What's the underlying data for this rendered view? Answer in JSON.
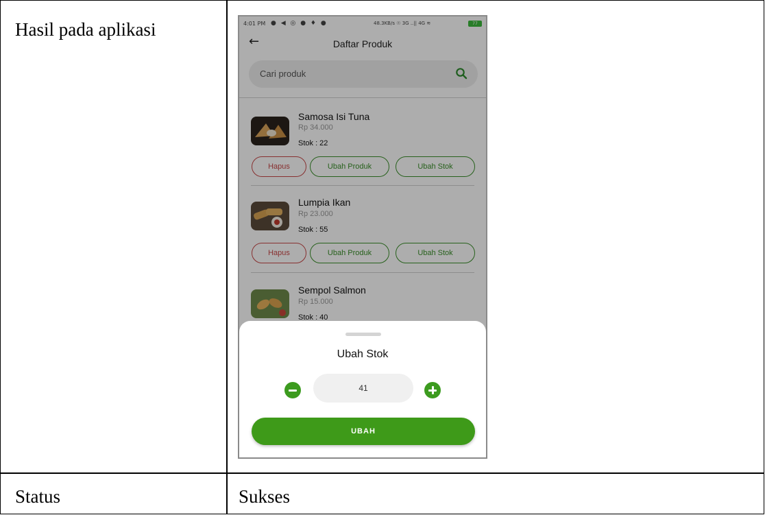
{
  "table": {
    "row1_label": "Hasil pada aplikasi",
    "row2_label": "Status",
    "row2_value": "Sukses"
  },
  "phone": {
    "statusbar": {
      "time": "4:01 PM",
      "network": "48.3KB/s",
      "signal": "3G ..|| 4G",
      "battery": "77"
    },
    "appbar": {
      "title": "Daftar Produk",
      "back_icon": "arrow-left-icon"
    },
    "search": {
      "placeholder": "Cari produk",
      "icon": "search-icon"
    },
    "products": [
      {
        "name": "Samosa Isi Tuna",
        "price": "Rp 34.000",
        "stock": "Stok : 22"
      },
      {
        "name": "Lumpia Ikan",
        "price": "Rp 23.000",
        "stock": "Stok : 55"
      },
      {
        "name": "Sempol Salmon",
        "price": "Rp 15.000",
        "stock": "Stok : 40"
      }
    ],
    "actions": {
      "delete": "Hapus",
      "edit_product": "Ubah Produk",
      "edit_stock": "Ubah Stok"
    },
    "sheet": {
      "title": "Ubah Stok",
      "quantity": "41",
      "submit": "UBAH"
    },
    "colors": {
      "primary_green": "#3e9a19",
      "delete_red": "#c84848",
      "outline_green": "#3a8f2a"
    }
  }
}
